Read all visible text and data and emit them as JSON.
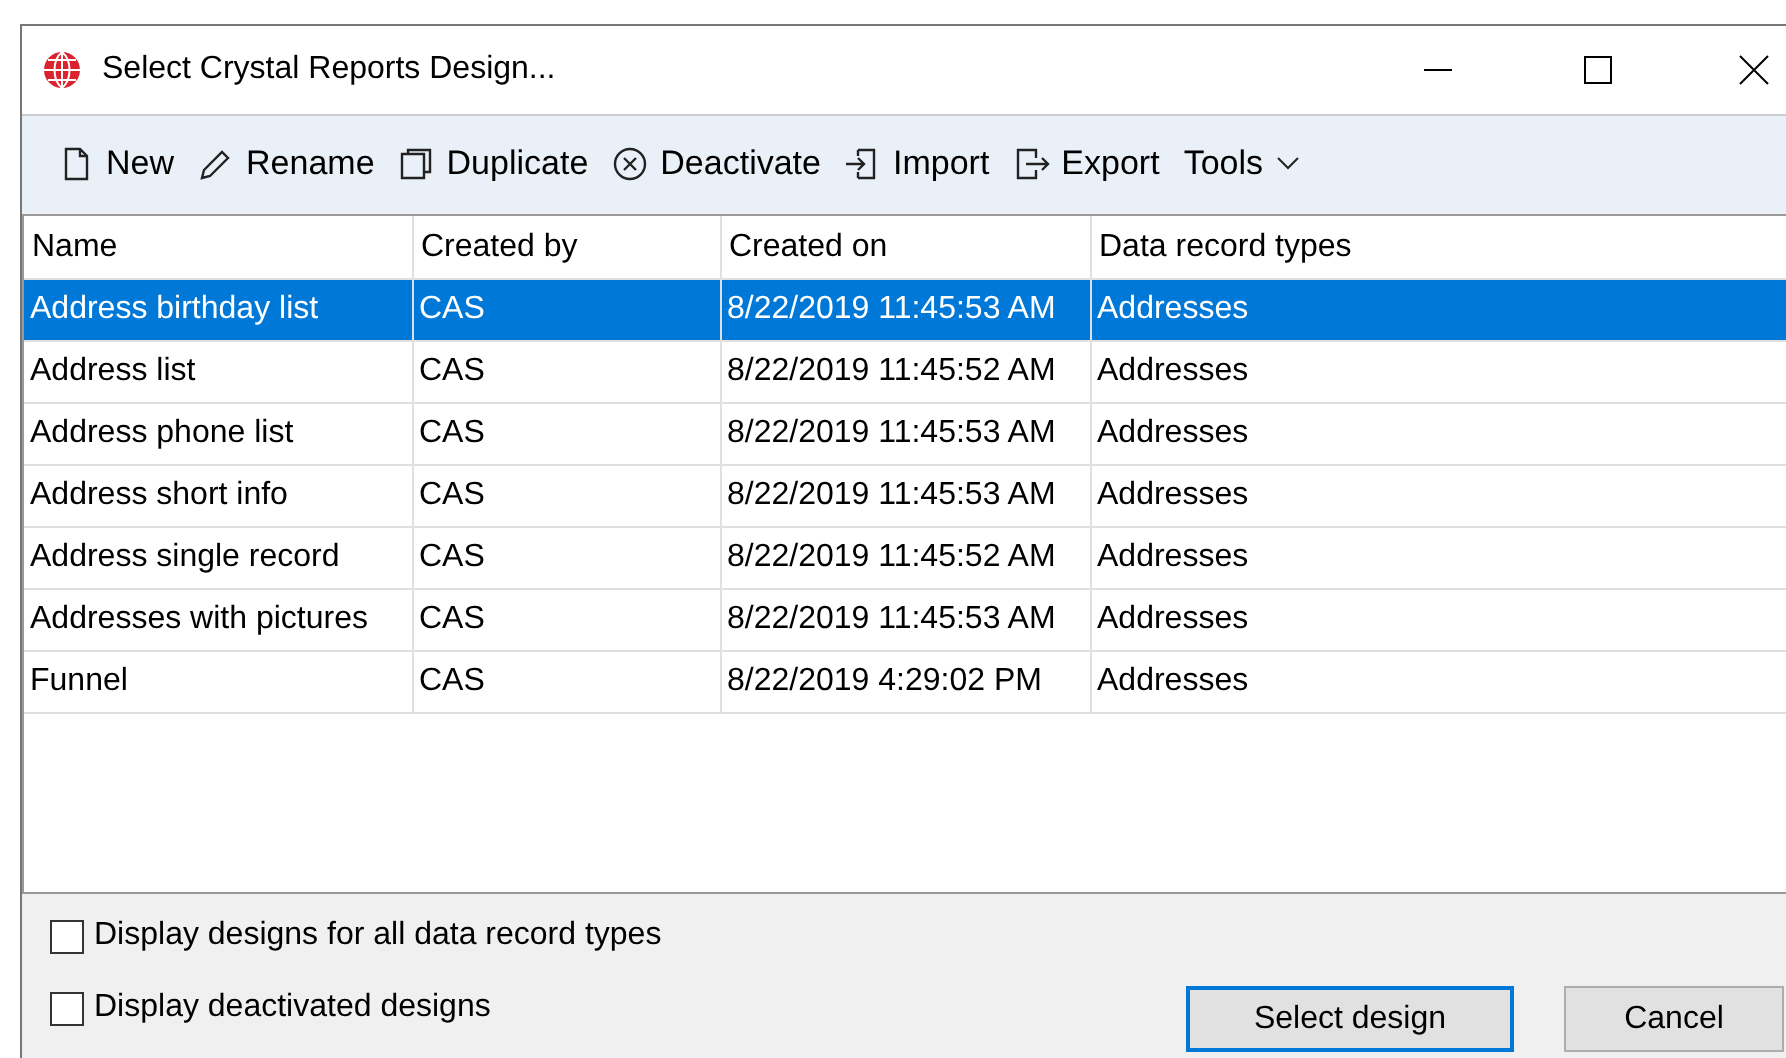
{
  "window": {
    "title": "Select Crystal Reports Design..."
  },
  "toolbar": [
    {
      "label": "New",
      "kind": "new"
    },
    {
      "label": "Rename",
      "kind": "rename"
    },
    {
      "label": "Duplicate",
      "kind": "duplicate"
    },
    {
      "label": "Deactivate",
      "kind": "deactivate"
    },
    {
      "label": "Import",
      "kind": "import"
    },
    {
      "label": "Export",
      "kind": "export"
    },
    {
      "label": "Tools",
      "kind": "menu"
    }
  ],
  "table": {
    "columns": [
      "Name",
      "Created by",
      "Created on",
      "Data record types"
    ],
    "rows": [
      {
        "cells": [
          "Address birthday list",
          "CAS",
          "8/22/2019 11:45:53 AM",
          "Addresses"
        ],
        "selected": true
      },
      {
        "cells": [
          "Address list",
          "CAS",
          "8/22/2019 11:45:52 AM",
          "Addresses"
        ],
        "selected": false
      },
      {
        "cells": [
          "Address phone list",
          "CAS",
          "8/22/2019 11:45:53 AM",
          "Addresses"
        ],
        "selected": false
      },
      {
        "cells": [
          "Address short info",
          "CAS",
          "8/22/2019 11:45:53 AM",
          "Addresses"
        ],
        "selected": false
      },
      {
        "cells": [
          "Address single record",
          "CAS",
          "8/22/2019 11:45:52 AM",
          "Addresses"
        ],
        "selected": false
      },
      {
        "cells": [
          "Addresses with pictures",
          "CAS",
          "8/22/2019 11:45:53 AM",
          "Addresses"
        ],
        "selected": false
      },
      {
        "cells": [
          "Funnel",
          "CAS",
          "8/22/2019 4:29:02 PM",
          "Addresses"
        ],
        "selected": false
      }
    ]
  },
  "options": [
    {
      "label": "Display designs for all data record types",
      "checked": false
    },
    {
      "label": "Display deactivated designs",
      "checked": false
    }
  ],
  "buttons": [
    {
      "label": "Select design",
      "default": true
    },
    {
      "label": "Cancel",
      "default": false
    }
  ]
}
